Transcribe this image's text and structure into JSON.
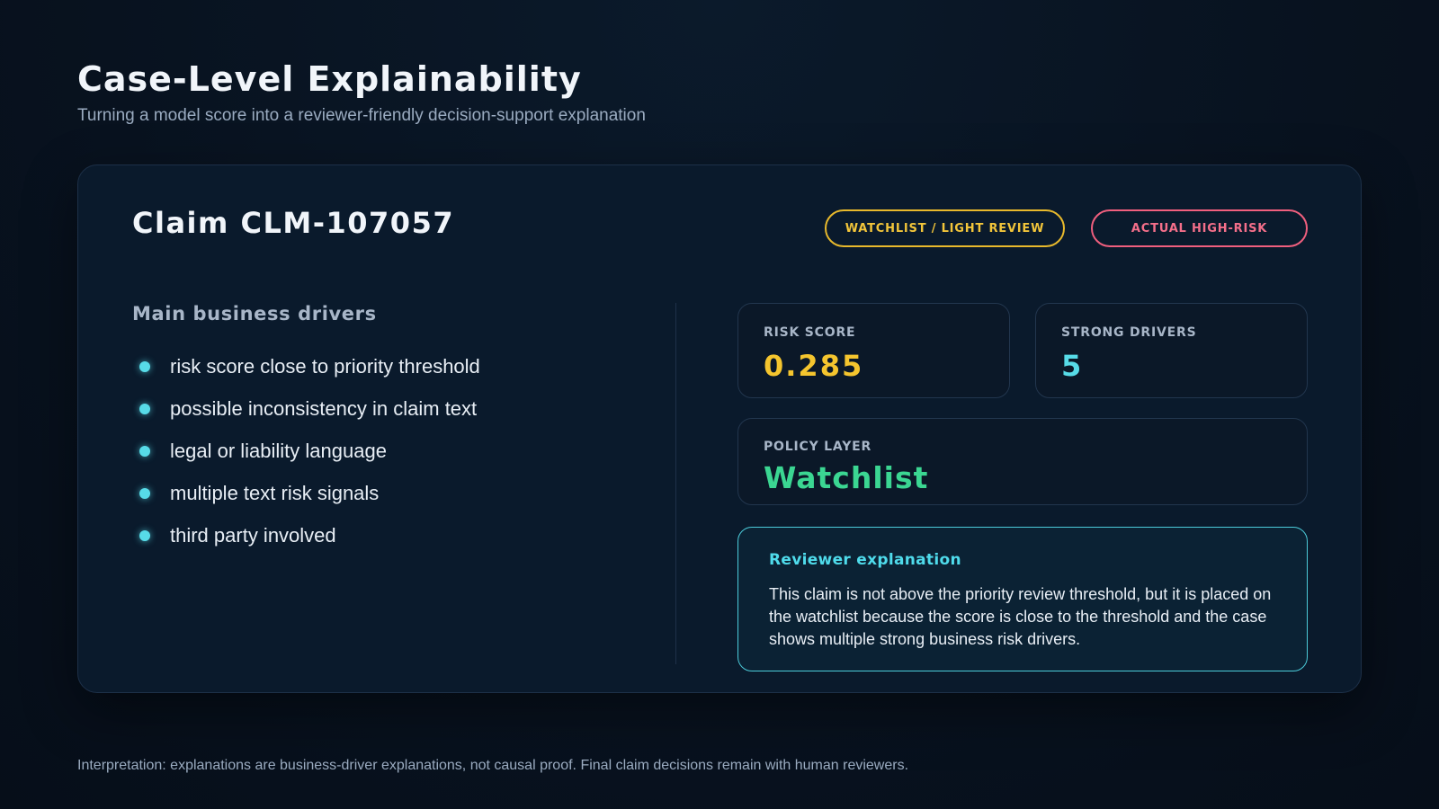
{
  "page": {
    "title": "Case-Level Explainability",
    "subtitle": "Turning a model score into a reviewer-friendly decision-support explanation"
  },
  "claim": {
    "title": "Claim CLM-107057",
    "badges": {
      "watchlist": "WATCHLIST / LIGHT REVIEW",
      "actual": "ACTUAL HIGH-RISK"
    }
  },
  "drivers": {
    "heading": "Main business drivers",
    "items": [
      "risk score close to priority threshold",
      "possible inconsistency in claim text",
      "legal or liability language",
      "multiple text risk signals",
      "third party involved"
    ]
  },
  "metrics": {
    "risk_score": {
      "label": "RISK SCORE",
      "value": "0.285"
    },
    "strong_drivers": {
      "label": "STRONG DRIVERS",
      "value": "5"
    },
    "policy_layer": {
      "label": "POLICY LAYER",
      "value": "Watchlist"
    }
  },
  "explanation": {
    "title": "Reviewer explanation",
    "text": "This claim is not above the priority review threshold, but it is placed on the watchlist because the score is close to the threshold and the case shows multiple strong business risk drivers."
  },
  "footnote": "Interpretation: explanations are business-driver explanations, not causal proof. Final claim decisions remain with human reviewers.",
  "colors": {
    "background": "#08121f",
    "accent_cyan": "#57dbe8",
    "score_yellow": "#f5c52e",
    "policy_green": "#3bd692",
    "badge_watch": "#e8b92c",
    "badge_risk": "#f05f7e"
  }
}
